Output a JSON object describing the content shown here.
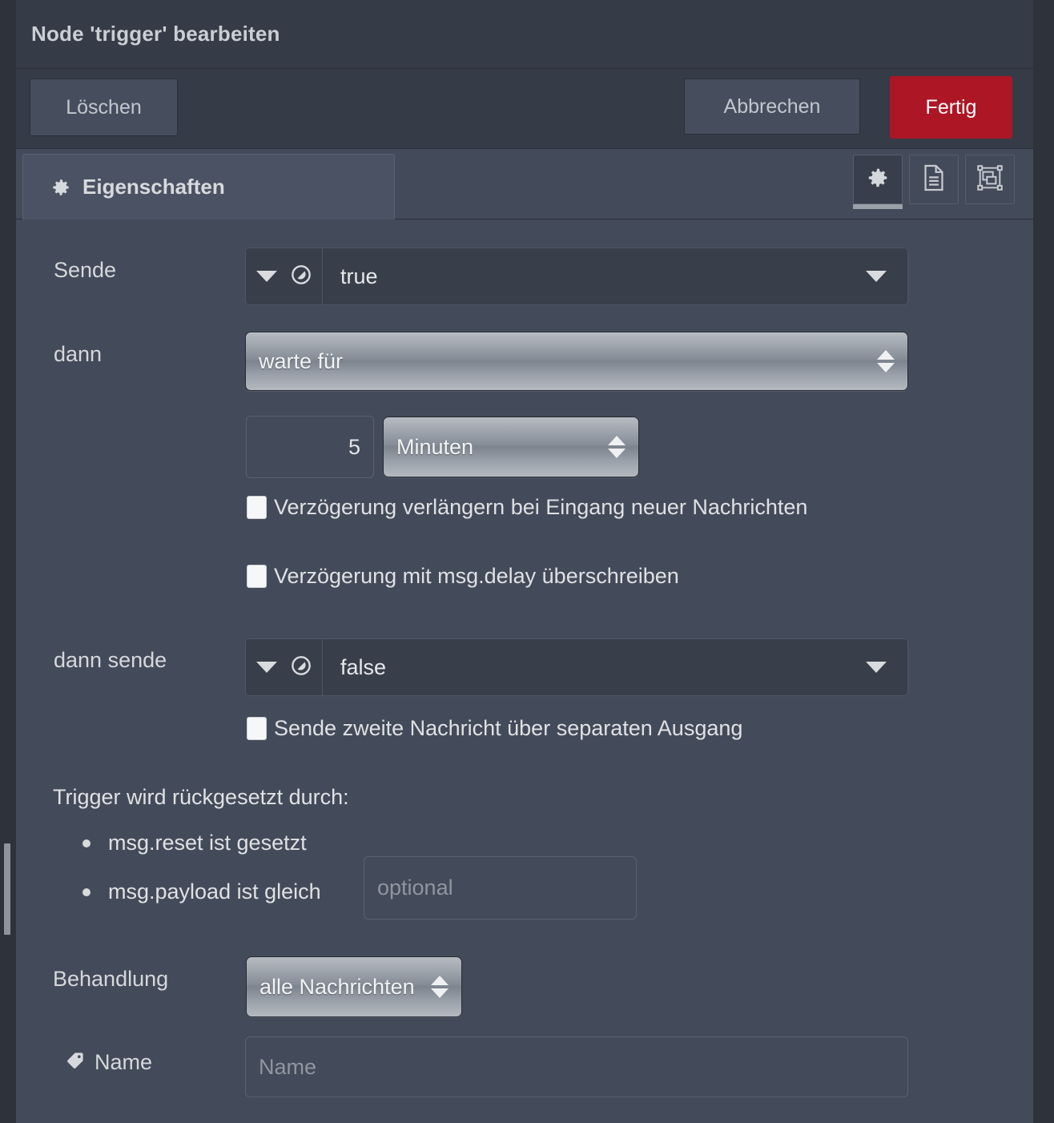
{
  "window": {
    "title": "Node 'trigger' bearbeiten"
  },
  "colors": {
    "accent_done": "#ad1625",
    "dialog_bg": "#434a59",
    "header_bg": "#353b47",
    "text": "#d5d8dc"
  },
  "toolbar": {
    "delete_label": "Löschen",
    "cancel_label": "Abbrechen",
    "done_label": "Fertig"
  },
  "tabs": {
    "properties_label": "Eigenschaften",
    "properties_icon": "gear-icon",
    "icon_buttons": [
      {
        "name": "gear-icon",
        "active": true
      },
      {
        "name": "description-icon",
        "active": false
      },
      {
        "name": "appearance-icon",
        "active": false
      }
    ]
  },
  "form": {
    "send": {
      "label": "Sende",
      "type_icon": "boolean-type-icon",
      "value": "true"
    },
    "then": {
      "label": "dann",
      "value": "warte für"
    },
    "duration": {
      "value": "5",
      "unit": "Minuten"
    },
    "checkbox_extend": {
      "label": "Verzögerung verlängern bei Eingang neuer Nachrichten",
      "checked": false
    },
    "checkbox_override": {
      "label": "Verzögerung mit msg.delay überschreiben",
      "checked": false
    },
    "then_send": {
      "label": "dann sende",
      "type_icon": "boolean-type-icon",
      "value": "false"
    },
    "checkbox_second_output": {
      "label": "Sende zweite Nachricht über separaten Ausgang",
      "checked": false
    },
    "reset": {
      "title": "Trigger wird rückgesetzt durch:",
      "items": [
        {
          "text": "msg.reset ist gesetzt"
        },
        {
          "text": "msg.payload ist gleich"
        }
      ],
      "payload_placeholder": "optional",
      "payload_value": ""
    },
    "handling": {
      "label": "Behandlung",
      "value": "alle Nachrichten"
    },
    "name": {
      "label": "Name",
      "icon": "tag-icon",
      "placeholder": "Name",
      "value": ""
    }
  }
}
